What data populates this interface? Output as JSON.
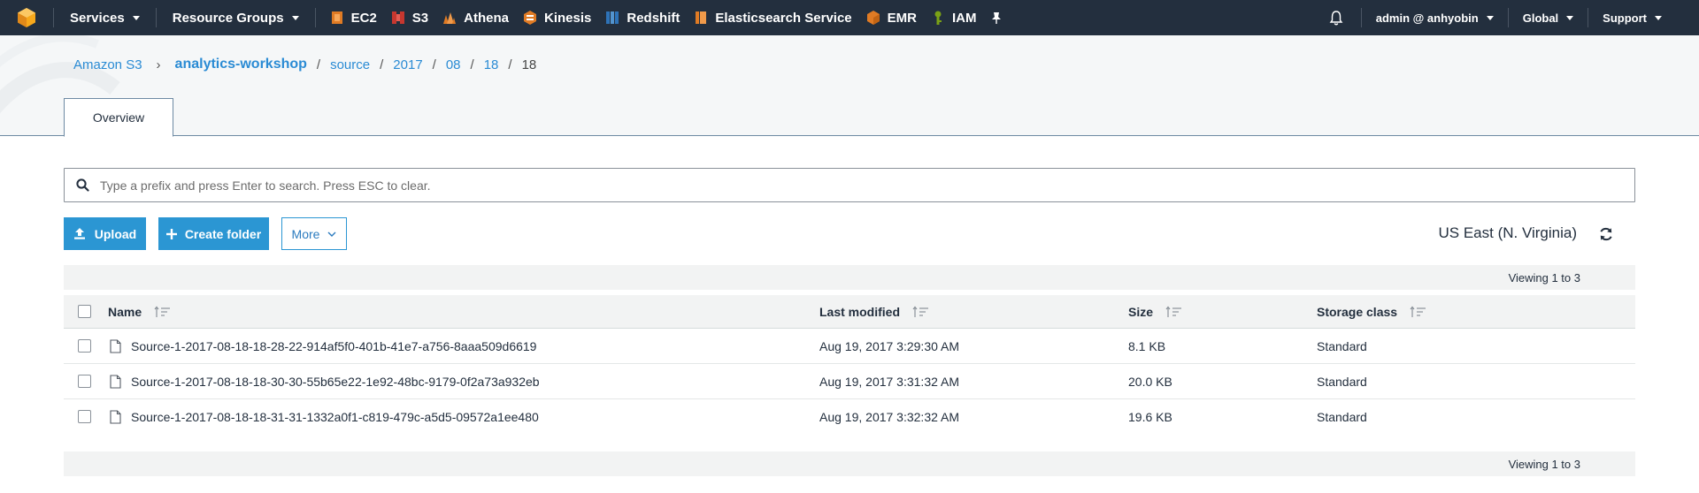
{
  "nav": {
    "services": "Services",
    "resource_groups": "Resource Groups",
    "shortcuts": [
      {
        "label": "EC2",
        "icon": "ec2-icon",
        "color": "#e07b24"
      },
      {
        "label": "S3",
        "icon": "s3-icon",
        "color": "#c7372f"
      },
      {
        "label": "Athena",
        "icon": "athena-icon",
        "color": "#e07b24"
      },
      {
        "label": "Kinesis",
        "icon": "kinesis-icon",
        "color": "#e07b24"
      },
      {
        "label": "Redshift",
        "icon": "redshift-icon",
        "color": "#2e73b8"
      },
      {
        "label": "Elasticsearch Service",
        "icon": "elasticsearch-icon",
        "color": "#e07b24"
      },
      {
        "label": "EMR",
        "icon": "emr-icon",
        "color": "#e07b24"
      },
      {
        "label": "IAM",
        "icon": "iam-icon",
        "color": "#7aa116"
      }
    ],
    "user": "admin @ anhyobin",
    "region": "Global",
    "support": "Support"
  },
  "breadcrumb": {
    "root": "Amazon S3",
    "bucket": "analytics-workshop",
    "path": [
      "source",
      "2017",
      "08",
      "18"
    ],
    "current": "18"
  },
  "tabs": {
    "overview": "Overview"
  },
  "search": {
    "placeholder": "Type a prefix and press Enter to search. Press ESC to clear."
  },
  "toolbar": {
    "upload": "Upload",
    "create_folder": "Create folder",
    "more": "More",
    "region": "US East (N. Virginia)"
  },
  "table": {
    "viewing_top": "Viewing 1 to 3",
    "viewing_bottom": "Viewing 1 to 3",
    "columns": {
      "name": "Name",
      "last_modified": "Last modified",
      "size": "Size",
      "storage_class": "Storage class"
    },
    "rows": [
      {
        "name": "Source-1-2017-08-18-18-28-22-914af5f0-401b-41e7-a756-8aaa509d6619",
        "last_modified": "Aug 19, 2017 3:29:30 AM",
        "size": "8.1 KB",
        "storage_class": "Standard"
      },
      {
        "name": "Source-1-2017-08-18-18-30-30-55b65e22-1e92-48bc-9179-0f2a73a932eb",
        "last_modified": "Aug 19, 2017 3:31:32 AM",
        "size": "20.0 KB",
        "storage_class": "Standard"
      },
      {
        "name": "Source-1-2017-08-18-18-31-31-1332a0f1-c819-479c-a5d5-09572a1ee480",
        "last_modified": "Aug 19, 2017 3:32:32 AM",
        "size": "19.6 KB",
        "storage_class": "Standard"
      }
    ]
  },
  "colors": {
    "nav_bg": "#232f3e",
    "link": "#2a8bd4",
    "primary_button": "#2b96d3",
    "aws_logo": "#f7a81b"
  }
}
